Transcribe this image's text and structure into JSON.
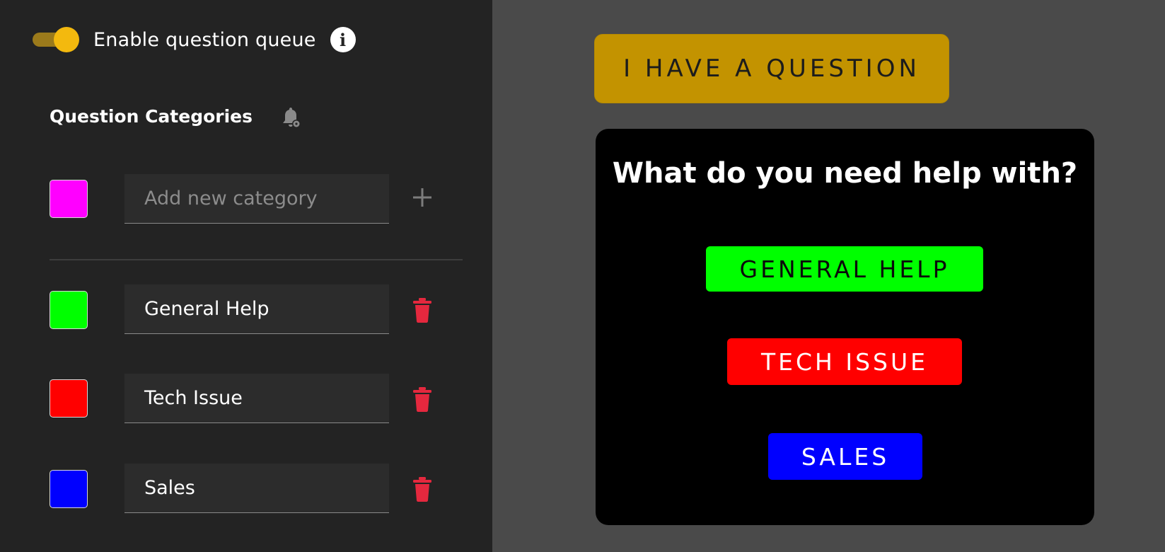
{
  "settings": {
    "toggle_label": "Enable question queue",
    "toggle_enabled": true,
    "info_icon": "info-icon",
    "section_title": "Question Categories",
    "section_icon": "bell-settings-icon"
  },
  "new_category": {
    "color": "#ff00ff",
    "placeholder": "Add new category",
    "action_icon": "plus-icon"
  },
  "categories": [
    {
      "label": "General Help",
      "color": "#00ff00"
    },
    {
      "label": "Tech Issue",
      "color": "#ff0000"
    },
    {
      "label": "Sales",
      "color": "#0000ff"
    }
  ],
  "preview": {
    "ask_button_label": "I HAVE A QUESTION",
    "ask_button_color": "#c39300",
    "prompt_title": "What do you need help with?",
    "buttons": [
      {
        "label": "GENERAL HELP",
        "color": "#00ff00"
      },
      {
        "label": "TECH ISSUE",
        "color": "#ff0000"
      },
      {
        "label": "SALES",
        "color": "#0000ff"
      }
    ]
  },
  "colors": {
    "panel_bg": "#232323",
    "page_bg": "#4a4a4a",
    "toggle_accent": "#f3b90e",
    "delete_icon": "#e5283e"
  }
}
